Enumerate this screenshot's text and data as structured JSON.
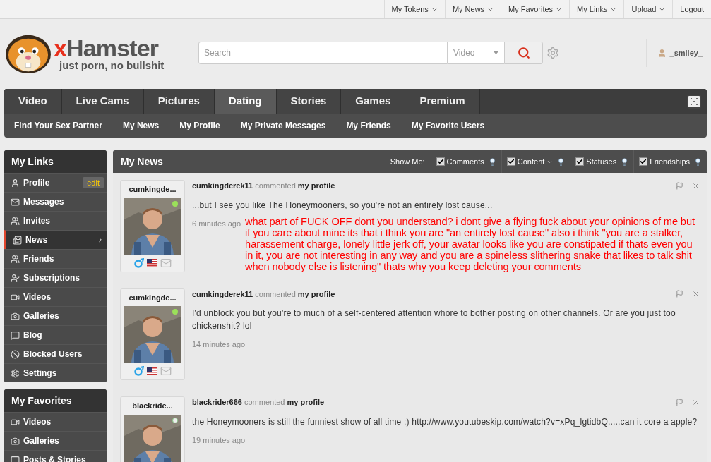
{
  "top_menu": [
    {
      "label": "My Tokens",
      "dropdown": true
    },
    {
      "label": "My News",
      "dropdown": true
    },
    {
      "label": "My Favorites",
      "dropdown": true
    },
    {
      "label": "My Links",
      "dropdown": true
    },
    {
      "label": "Upload",
      "dropdown": true
    },
    {
      "label": "Logout",
      "dropdown": false
    }
  ],
  "logo": {
    "name_x": "x",
    "name_rest": "Hamster",
    "tagline": "just porn, no bullshit"
  },
  "search": {
    "placeholder": "Search",
    "category": "Video"
  },
  "user": {
    "name": "_smiley_"
  },
  "main_tabs": [
    {
      "label": "Video",
      "selected": false
    },
    {
      "label": "Live Cams",
      "selected": false
    },
    {
      "label": "Pictures",
      "selected": false
    },
    {
      "label": "Dating",
      "selected": true
    },
    {
      "label": "Stories",
      "selected": false
    },
    {
      "label": "Games",
      "selected": false
    },
    {
      "label": "Premium",
      "selected": false
    }
  ],
  "sub_nav": [
    "Find Your Sex Partner",
    "My News",
    "My Profile",
    "My Private Messages",
    "My Friends",
    "My Favorite Users"
  ],
  "sidebar": [
    {
      "title": "My Links",
      "items": [
        {
          "kind": "profile",
          "label": "Profile",
          "selected": false,
          "badge": "edit"
        },
        {
          "kind": "messages",
          "label": "Messages",
          "selected": false
        },
        {
          "kind": "invites",
          "label": "Invites",
          "selected": false
        },
        {
          "kind": "news",
          "label": "News",
          "selected": true
        },
        {
          "kind": "friends",
          "label": "Friends",
          "selected": false
        },
        {
          "kind": "subscriptions",
          "label": "Subscriptions",
          "selected": false
        },
        {
          "kind": "videos",
          "label": "Videos",
          "selected": false
        },
        {
          "kind": "galleries",
          "label": "Galleries",
          "selected": false
        },
        {
          "kind": "blog",
          "label": "Blog",
          "selected": false
        },
        {
          "kind": "blocked",
          "label": "Blocked Users",
          "selected": false
        },
        {
          "kind": "settings",
          "label": "Settings",
          "selected": false
        }
      ]
    },
    {
      "title": "My Favorites",
      "items": [
        {
          "kind": "videos",
          "label": "Videos",
          "selected": false
        },
        {
          "kind": "galleries",
          "label": "Galleries",
          "selected": false
        },
        {
          "kind": "blog",
          "label": "Posts & Stories",
          "selected": false
        }
      ]
    }
  ],
  "news": {
    "title": "My News",
    "filter_label": "Show Me:",
    "filters": [
      {
        "label": "Comments",
        "checked": true,
        "dropdown": false
      },
      {
        "label": "Content",
        "checked": true,
        "dropdown": true
      },
      {
        "label": "Statuses",
        "checked": true,
        "dropdown": false
      },
      {
        "label": "Friendships",
        "checked": true,
        "dropdown": false
      }
    ],
    "items": [
      {
        "author_short": "cumkingde...",
        "online": true,
        "badges": true,
        "author": "cumkingderek11",
        "action": "commented",
        "target": "my profile",
        "text": "...but I see you like The Honeymooners, so you're not an entirely lost cause...",
        "time": "6 minutes ago",
        "reply": "what part of FUCK OFF dont you understand? i dont give a flying fuck about your opinions of me but if you care about mine its that i think you are \"an entirely lost cause\" also i think \"you are a stalker, harassement charge, lonely little jerk off, your avatar looks like you are constipated if thats even you in it, you are not interesting in any way and you are a spineless slithering snake that likes to talk shit when nobody else is listening\" thats why you keep deleting your comments"
      },
      {
        "author_short": "cumkingde...",
        "online": true,
        "badges": true,
        "author": "cumkingderek11",
        "action": "commented",
        "target": "my profile",
        "text": "I'd unblock you but you're to much of a self-centered attention whore to bother posting on other channels. Or are you just too chickenshit? lol",
        "time": "14 minutes ago"
      },
      {
        "author_short": "blackride...",
        "online": false,
        "badges": false,
        "author": "blackrider666",
        "action": "commented",
        "target": "my profile",
        "text": "the Honeymooners is still the funniest show of all time ;) http://www.youtubeskip.com/watch?v=xPq_lgtidbQ.....can it core a apple?",
        "time": "19 minutes ago"
      }
    ]
  }
}
